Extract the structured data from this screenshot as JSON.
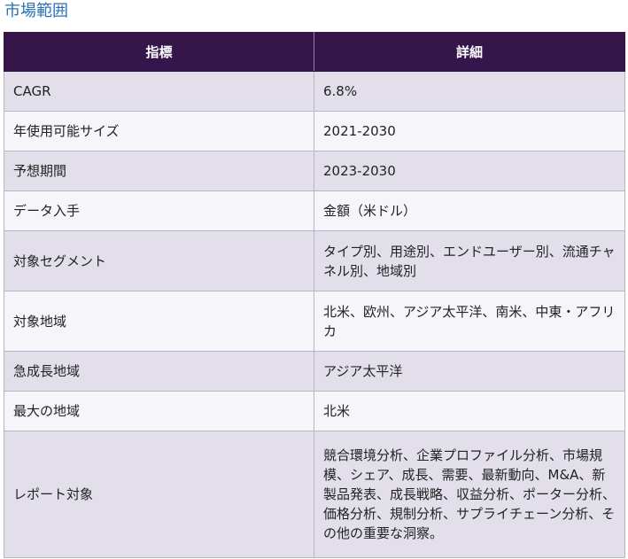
{
  "title": "市場範囲",
  "table": {
    "headers": [
      "指標",
      "詳細"
    ],
    "rows": [
      {
        "key": "CAGR",
        "value": "6.8%"
      },
      {
        "key": "年使用可能サイズ",
        "value": "2021-2030"
      },
      {
        "key": "予想期間",
        "value": "2023-2030"
      },
      {
        "key": "データ入手",
        "value": "金額（米ドル）"
      },
      {
        "key": "対象セグメント",
        "value": "タイプ別、用途別、エンドユーザー別、流通チャネル別、地域別"
      },
      {
        "key": "対象地域",
        "value": "北米、欧州、アジア太平洋、南米、中東・アフリカ"
      },
      {
        "key": "急成長地域",
        "value": "アジア太平洋"
      },
      {
        "key": "最大の地域",
        "value": "北米"
      },
      {
        "key": "レポート対象",
        "value": "競合環境分析、企業プロファイル分析、市場規模、シェア、成長、需要、最新動向、M&A、新製品発表、成長戦略、収益分析、ポーター分析、価格分析、規制分析、サプライチェーン分析、その他の重要な洞察。"
      }
    ]
  }
}
